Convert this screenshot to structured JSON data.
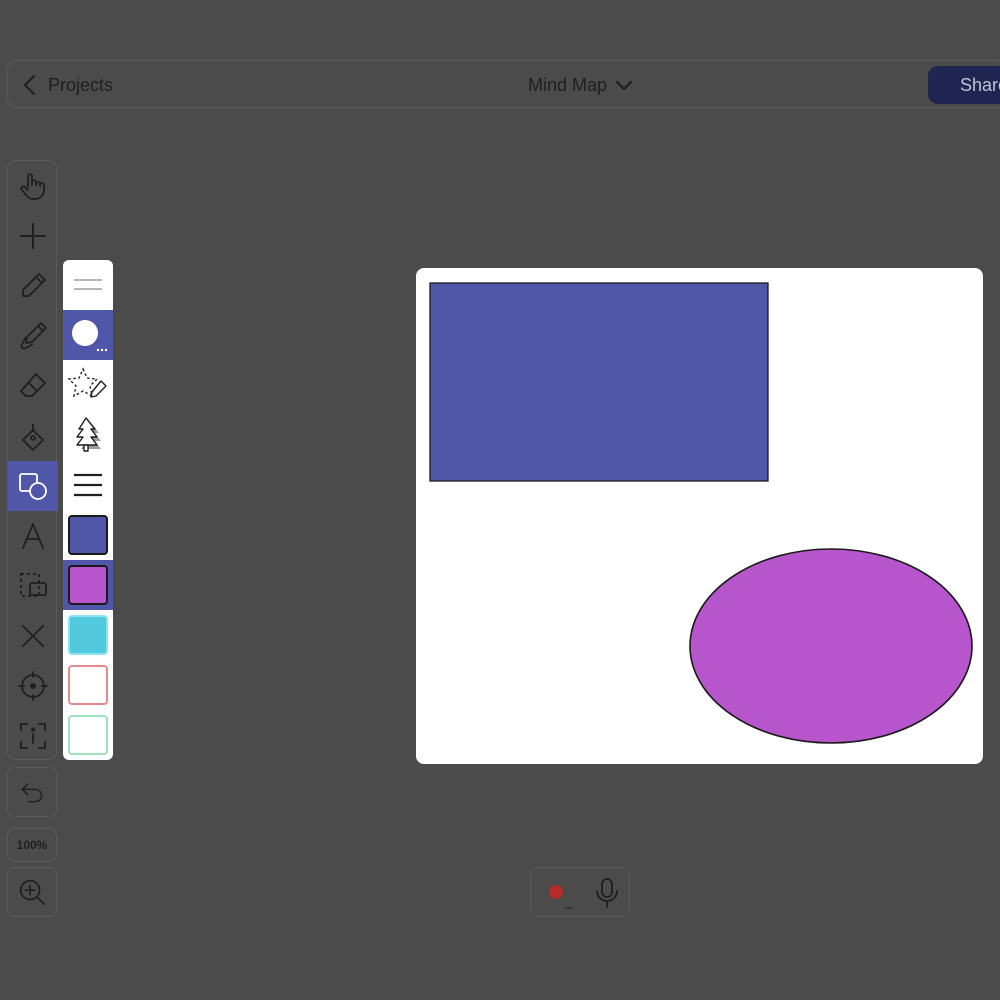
{
  "topbar": {
    "back_label": "Projects",
    "title": "Mind Map",
    "share_label": "Share"
  },
  "left_toolbar": {
    "tools": [
      {
        "name": "hand-tool",
        "icon": "hand-icon"
      },
      {
        "name": "add-tool",
        "icon": "plus-icon"
      },
      {
        "name": "pencil-tool",
        "icon": "pencil-icon"
      },
      {
        "name": "marker-tool",
        "icon": "marker-icon"
      },
      {
        "name": "eraser-tool",
        "icon": "eraser-icon"
      },
      {
        "name": "fill-tool",
        "icon": "paint-bucket-icon"
      },
      {
        "name": "shapes-tool",
        "icon": "shapes-icon",
        "active": true
      },
      {
        "name": "text-tool",
        "icon": "text-icon"
      },
      {
        "name": "selection-tool",
        "icon": "selection-icon"
      },
      {
        "name": "clear-tool",
        "icon": "close-icon"
      },
      {
        "name": "target-tool",
        "icon": "crosshair-icon"
      },
      {
        "name": "info-tool",
        "icon": "info-icon"
      }
    ],
    "undo_icon": "undo-icon",
    "zoom_level": "100%",
    "zoom_icon": "zoom-in-icon"
  },
  "shape_panel": {
    "swatches": [
      {
        "fill": "#5157a8",
        "border": "#1a1a1a"
      },
      {
        "fill": "#b755cc",
        "border": "#1a1a1a",
        "active": true
      },
      {
        "fill": "#4fc9db",
        "border": "#8ee3ee"
      },
      {
        "fill": "#ffffff",
        "border": "#e88a8a"
      },
      {
        "fill": "#ffffff",
        "border": "#9fe0bf"
      }
    ]
  },
  "colors": {
    "accent": "#5157a8",
    "background": "#4b4b4b",
    "rectangle_fill": "#5157a8",
    "ellipse_fill": "#b755cc",
    "record_red": "#b52a2a"
  }
}
